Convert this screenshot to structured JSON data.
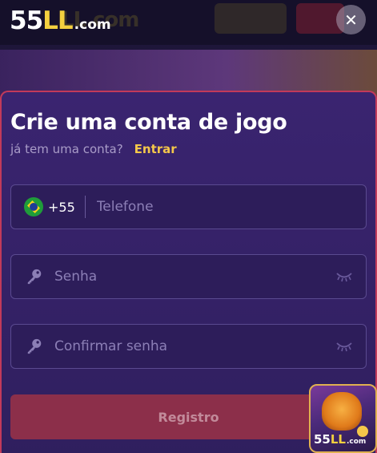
{
  "brand": {
    "logo_num": "55",
    "logo_ll": "LL",
    "logo_domain": ".com",
    "accent": "#f4d03f"
  },
  "modal": {
    "title": "Crie uma conta de jogo",
    "subtitle": "já tem uma conta?",
    "login_link": "Entrar",
    "close_icon": "close-icon"
  },
  "form": {
    "phone": {
      "country_code": "+55",
      "placeholder": "Telefone",
      "flag_icon": "brazil-flag-icon"
    },
    "password": {
      "placeholder": "Senha",
      "icon": "key-icon",
      "toggle_icon": "eye-closed-icon"
    },
    "confirm_password": {
      "placeholder": "Confirmar senha",
      "icon": "key-icon",
      "toggle_icon": "eye-closed-icon"
    },
    "submit_label": "Registro",
    "submit_color": "#8c2f4a"
  },
  "promo": {
    "logo_num": "55",
    "logo_ll": "LL",
    "logo_domain": ".com"
  }
}
